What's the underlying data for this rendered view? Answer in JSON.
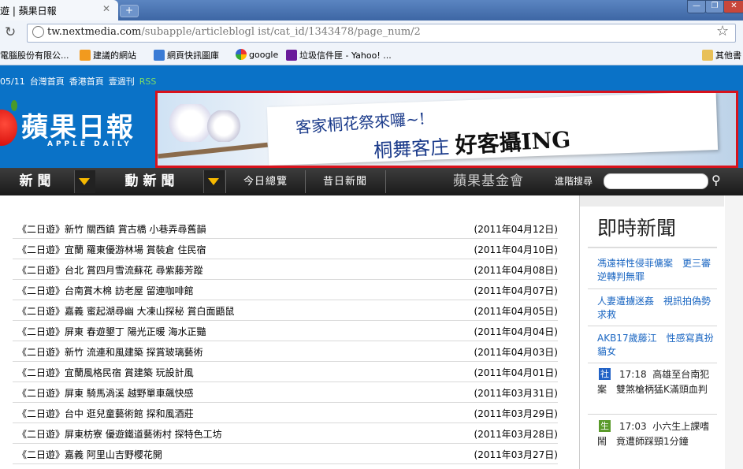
{
  "browser": {
    "tab_title": "遊 | 蘋果日報",
    "tab_close": "✕",
    "new_tab": "+",
    "url_host": "tw.nextmedia.com",
    "url_path": "/subapple/articleblogl ist/cat_id/1343478/page_num/2",
    "bookmarks": [
      {
        "label": "電腦股份有限公...",
        "icon": "folder-icon"
      },
      {
        "label": "建議的網站",
        "icon": "suggested-sites-icon"
      },
      {
        "label": "網頁快訊圖庫",
        "icon": "web-slice-icon"
      },
      {
        "label": "google",
        "icon": "google-icon"
      },
      {
        "label": "垃圾信件匣 - Yahoo! ...",
        "icon": "yahoo-icon"
      },
      {
        "label": "其他書",
        "icon": "folder-icon"
      }
    ]
  },
  "site": {
    "topnav": {
      "date": "05/11",
      "links": [
        "台灣首頁",
        "香港首頁",
        "壹週刊"
      ],
      "rss": "RSS"
    },
    "logo_cn": "蘋果日報",
    "logo_en": "APPLE DAILY",
    "banner": {
      "line1": "客家桐花祭來囉~!",
      "line2": "桐舞客庄",
      "line2_big": "好客攝ING"
    },
    "mainnav": {
      "news": "新聞",
      "video_news": "動新聞",
      "today": "今日總覽",
      "past": "昔日新聞",
      "foundation": "蘋果基金會",
      "advanced_search": "進階搜尋"
    }
  },
  "articles": [
    {
      "title": "《二日遊》新竹 關西鎮 賞古橋 小巷弄尋舊韻",
      "date": "(2011年04月12日)"
    },
    {
      "title": "《二日遊》宜蘭 羅東優游林場 賞裝倉 住民宿",
      "date": "(2011年04月10日)"
    },
    {
      "title": "《二日遊》台北 賞四月雪流蘇花 尋紫藤芳蹤",
      "date": "(2011年04月08日)"
    },
    {
      "title": "《二日遊》台南賞木棉 訪老屋 留連咖啡館",
      "date": "(2011年04月07日)"
    },
    {
      "title": "《二日遊》嘉義 蜜起湖尋幽 大凍山探秘 賞白面鼯鼠",
      "date": "(2011年04月05日)"
    },
    {
      "title": "《二日遊》屏東 春遊墾丁 陽光正暖 海水正豔",
      "date": "(2011年04月04日)"
    },
    {
      "title": "《二日遊》新竹 流連和風建築 探賞玻璃藝術",
      "date": "(2011年04月03日)"
    },
    {
      "title": "《二日遊》宜蘭風格民宿 賞建築 玩設計風",
      "date": "(2011年04月01日)"
    },
    {
      "title": "《二日遊》屏東 騎馬渦溪 越野單車飆快感",
      "date": "(2011年03月31日)"
    },
    {
      "title": "《二日遊》台中 逛兒童藝術館 探和風酒莊",
      "date": "(2011年03月29日)"
    },
    {
      "title": "《二日遊》屏東枋寮 優遊鐵道藝術村 探特色工坊",
      "date": "(2011年03月28日)"
    },
    {
      "title": "《二日遊》嘉義 阿里山吉野櫻花開",
      "date": "(2011年03月27日)"
    }
  ],
  "sidebar": {
    "heading": "即時新聞",
    "links": [
      "馮遠祥性侵菲傭案　更三審逆轉判無罪",
      "人妻遭擄迷姦　視訊拍偽勢求救",
      "AKB17歲藤江　性感寫真扮貓女"
    ],
    "items": [
      {
        "badge": "社",
        "badge_color": "#2262c6",
        "time": "17:18",
        "text": "高雄至台南犯案　雙煞槍柄猛K滿頭血判"
      },
      {
        "badge": "生",
        "badge_color": "#5a9a2a",
        "time": "17:03",
        "text": "小六生上課嗜鬧　竟遭師踩頸1分鐘"
      }
    ]
  },
  "colors": {
    "site_blue": "#0a72c7",
    "nav_dark": "#1a1a1a",
    "banner_border": "#d8121c",
    "link_blue": "#1a66c2",
    "dropdown_yellow": "#f5b800"
  }
}
